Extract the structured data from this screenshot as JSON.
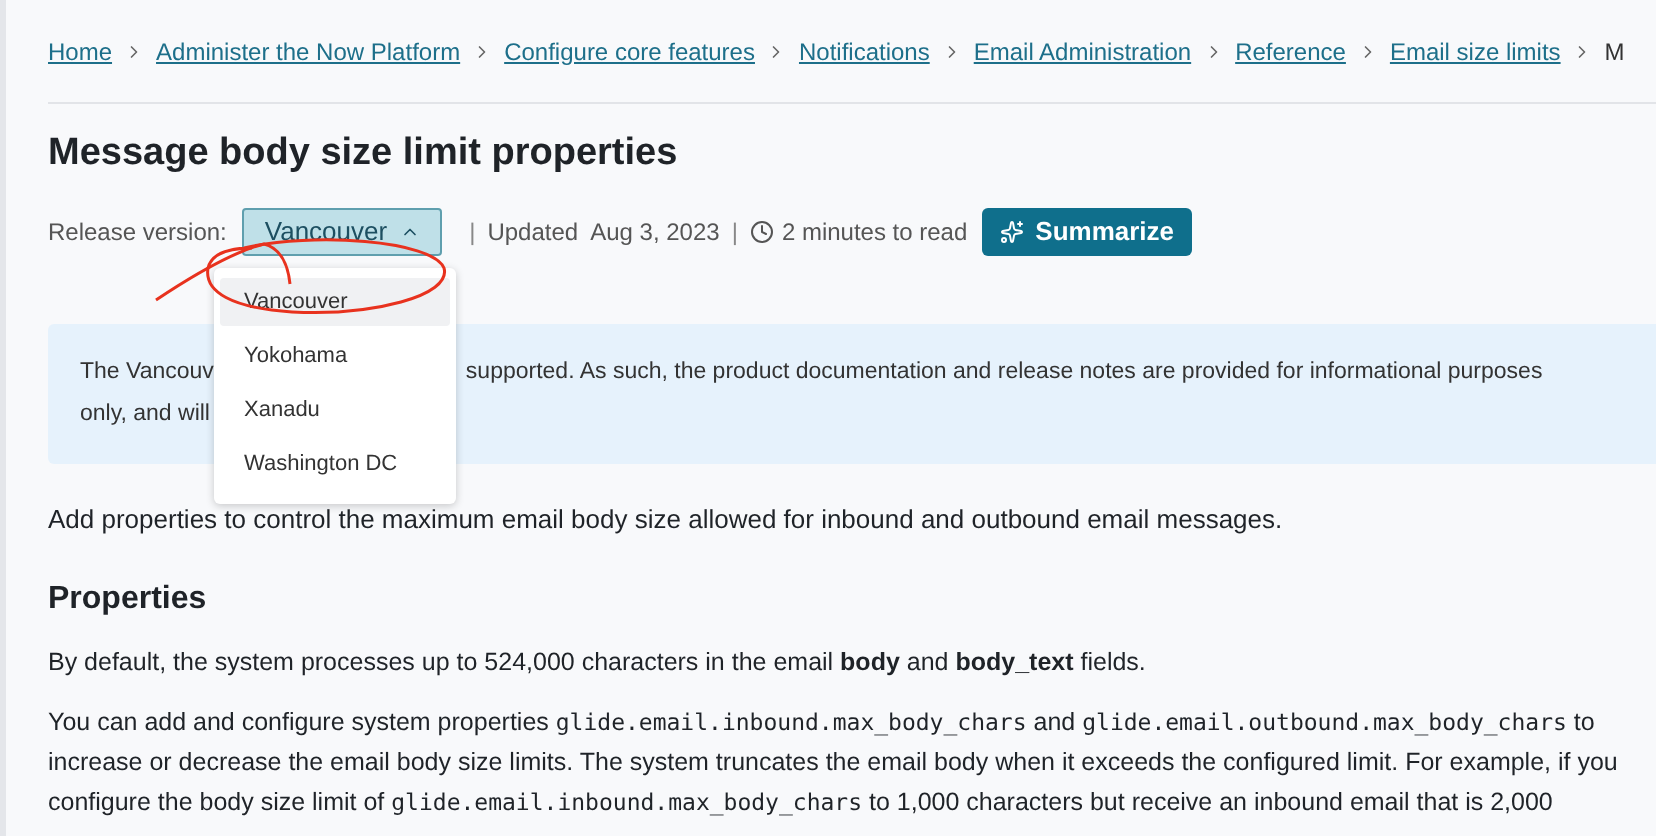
{
  "breadcrumbs": [
    {
      "label": "Home"
    },
    {
      "label": "Administer the Now Platform"
    },
    {
      "label": "Configure core features"
    },
    {
      "label": "Notifications"
    },
    {
      "label": "Email Administration"
    },
    {
      "label": "Reference"
    },
    {
      "label": "Email size limits"
    },
    {
      "label": "M"
    }
  ],
  "title": "Message body size limit properties",
  "release": {
    "label": "Release version:",
    "value": "Vancouver",
    "expanded": true,
    "options": [
      {
        "label": "Vancouver",
        "selected": true
      },
      {
        "label": "Yokohama",
        "selected": false
      },
      {
        "label": "Xanadu",
        "selected": false
      },
      {
        "label": "Washington DC",
        "selected": false
      }
    ]
  },
  "meta": {
    "separator": "|",
    "updated_label": "Updated",
    "updated_date": "Aug 3, 2023",
    "read_time": "2 minutes to read"
  },
  "summarize_button": "Summarize",
  "notice": {
    "lines": [
      [
        "The Vancouv",
        "supported. As such, the product documentation and release notes are provided for informational purposes"
      ],
      [
        "only, and will"
      ]
    ]
  },
  "intro": "Add properties to control the maximum email body size allowed for inbound and outbound email messages.",
  "section_heading": "Properties",
  "paragraphs": [
    [
      {
        "kind": "text",
        "text": "By default, the system processes up to 524,000 characters in the email **body** and **body_text** fields."
      }
    ],
    [
      {
        "kind": "text",
        "text": "You can add and configure system properties "
      },
      {
        "kind": "code",
        "text": "glide.email.inbound.max_body_chars"
      },
      {
        "kind": "text",
        "text": " and "
      },
      {
        "kind": "code",
        "text": "glide.email.outbound.max_body_chars"
      },
      {
        "kind": "text",
        "text": " to increase or decrease the email body size limits. The system truncates the email body when it exceeds the configured limit. For example, if you configure the body size limit of "
      },
      {
        "kind": "code",
        "text": "glide.email.inbound.max_body_chars"
      },
      {
        "kind": "text",
        "text": " to 1,000 characters but receive an inbound email that is 2,000"
      }
    ]
  ],
  "annotation": {
    "kind": "circle"
  }
}
